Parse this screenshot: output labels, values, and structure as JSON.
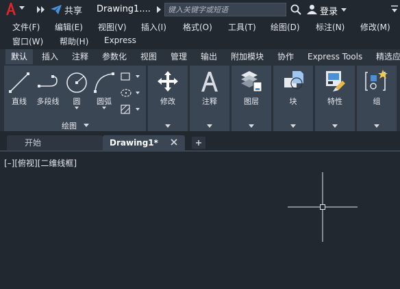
{
  "titlebar": {
    "share_label": "共享",
    "doc_title": "Drawing1....",
    "search_placeholder": "键入关键字或短语",
    "login_label": "登录",
    "colors": {
      "logo": "#e0262b",
      "share_icon": "#4a90d9"
    }
  },
  "menubar": {
    "items": [
      {
        "label": "文件(F)"
      },
      {
        "label": "编辑(E)"
      },
      {
        "label": "视图(V)"
      },
      {
        "label": "插入(I)"
      },
      {
        "label": "格式(O)"
      },
      {
        "label": "工具(T)"
      },
      {
        "label": "绘图(D)"
      },
      {
        "label": "标注(N)"
      },
      {
        "label": "修改(M)"
      },
      {
        "label": "窗口(W)"
      },
      {
        "label": "帮助(H)"
      },
      {
        "label": "Express"
      }
    ]
  },
  "ribbon_tabs": [
    {
      "label": "默认"
    },
    {
      "label": "插入"
    },
    {
      "label": "注释"
    },
    {
      "label": "参数化"
    },
    {
      "label": "视图"
    },
    {
      "label": "管理"
    },
    {
      "label": "输出"
    },
    {
      "label": "附加模块"
    },
    {
      "label": "协作"
    },
    {
      "label": "Express Tools"
    },
    {
      "label": "精选应"
    }
  ],
  "ribbon": {
    "draw_panel": {
      "tools": [
        {
          "label": "直线",
          "icon": "line-icon"
        },
        {
          "label": "多段线",
          "icon": "polyline-icon"
        },
        {
          "label": "圆",
          "icon": "circle-icon"
        },
        {
          "label": "圆弧",
          "icon": "arc-icon"
        }
      ],
      "small_tools": [
        {
          "icon": "rectangle-icon"
        },
        {
          "icon": "ellipse-icon"
        },
        {
          "icon": "hatch-icon"
        }
      ],
      "title": "绘图"
    },
    "panels": [
      {
        "label": "修改",
        "icon": "move-icon"
      },
      {
        "label": "注释",
        "icon": "text-icon"
      },
      {
        "label": "图层",
        "icon": "layers-icon"
      },
      {
        "label": "块",
        "icon": "block-icon"
      },
      {
        "label": "特性",
        "icon": "properties-icon"
      },
      {
        "label": "组",
        "icon": "group-icon"
      }
    ]
  },
  "file_tabs": {
    "home_label": "开始",
    "doc_label": "Drawing1*"
  },
  "viewport": {
    "label": "[–][俯视][二维线框]"
  }
}
